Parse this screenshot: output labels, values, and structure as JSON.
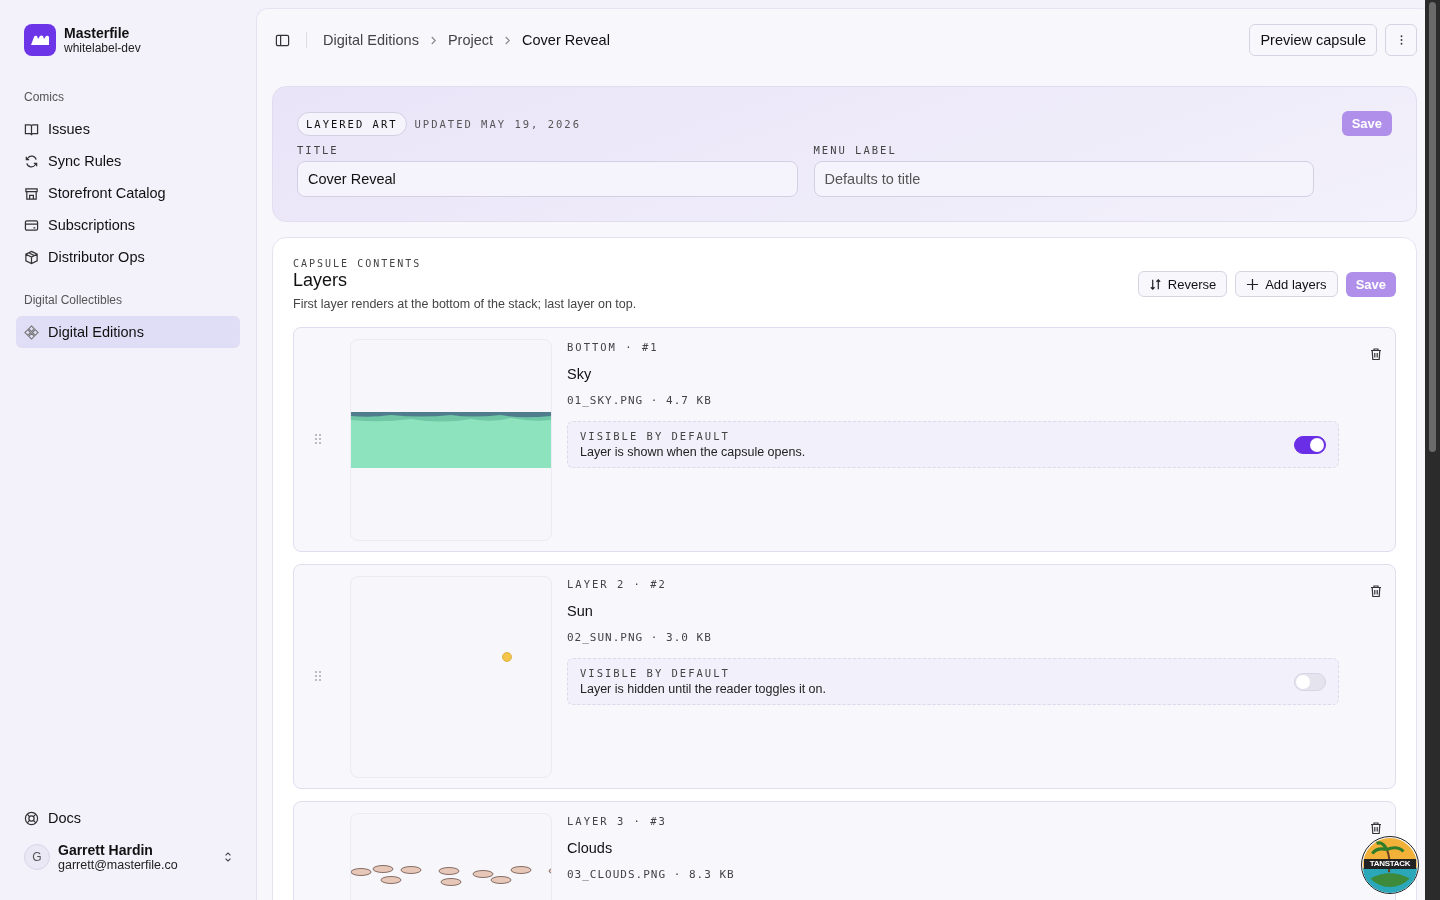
{
  "workspace": {
    "name": "Masterfile",
    "slug": "whitelabel-dev"
  },
  "sidebar": {
    "groups": [
      {
        "label": "Comics",
        "items": [
          {
            "label": "Issues",
            "selected": false
          },
          {
            "label": "Sync Rules",
            "selected": false
          },
          {
            "label": "Storefront Catalog",
            "selected": false
          },
          {
            "label": "Subscriptions",
            "selected": false
          },
          {
            "label": "Distributor Ops",
            "selected": false
          }
        ]
      },
      {
        "label": "Digital Collectibles",
        "items": [
          {
            "label": "Digital Editions",
            "selected": true
          }
        ]
      }
    ],
    "docs": "Docs",
    "user": {
      "initial": "G",
      "name": "Garrett Hardin",
      "email": "garrett@masterfile.co"
    }
  },
  "breadcrumbs": [
    "Digital Editions",
    "Project",
    "Cover Reveal"
  ],
  "header_buttons": {
    "preview": "Preview capsule"
  },
  "details": {
    "badge": "LAYERED ART",
    "updated": "UPDATED MAY 19, 2026",
    "save": "Save",
    "fields": [
      {
        "label": "TITLE",
        "value": "Cover Reveal"
      },
      {
        "label": "MENU LABEL",
        "placeholder": "Defaults to title"
      }
    ]
  },
  "layers_section": {
    "eyebrow": "CAPSULE CONTENTS",
    "title": "Layers",
    "description": "First layer renders at the bottom of the stack; last layer on top.",
    "buttons": {
      "reverse": "Reverse",
      "add": "Add layers",
      "save": "Save"
    },
    "layers": [
      {
        "position": "BOTTOM · #1",
        "name": "Sky",
        "file": "01_SKY.PNG · 4.7 KB",
        "kind": "sky",
        "toggle": {
          "label": "VISIBLE BY DEFAULT",
          "description": "Layer is shown when the capsule opens.",
          "on": true
        }
      },
      {
        "position": "LAYER 2 · #2",
        "name": "Sun",
        "file": "02_SUN.PNG · 3.0 KB",
        "kind": "sun",
        "toggle": {
          "label": "VISIBLE BY DEFAULT",
          "description": "Layer is hidden until the reader toggles it on.",
          "on": false
        }
      },
      {
        "position": "LAYER 3 · #3",
        "name": "Clouds",
        "file": "03_CLOUDS.PNG · 8.3 KB",
        "kind": "clouds"
      }
    ]
  },
  "devtools_badge": {
    "label": "TANSTACK"
  }
}
